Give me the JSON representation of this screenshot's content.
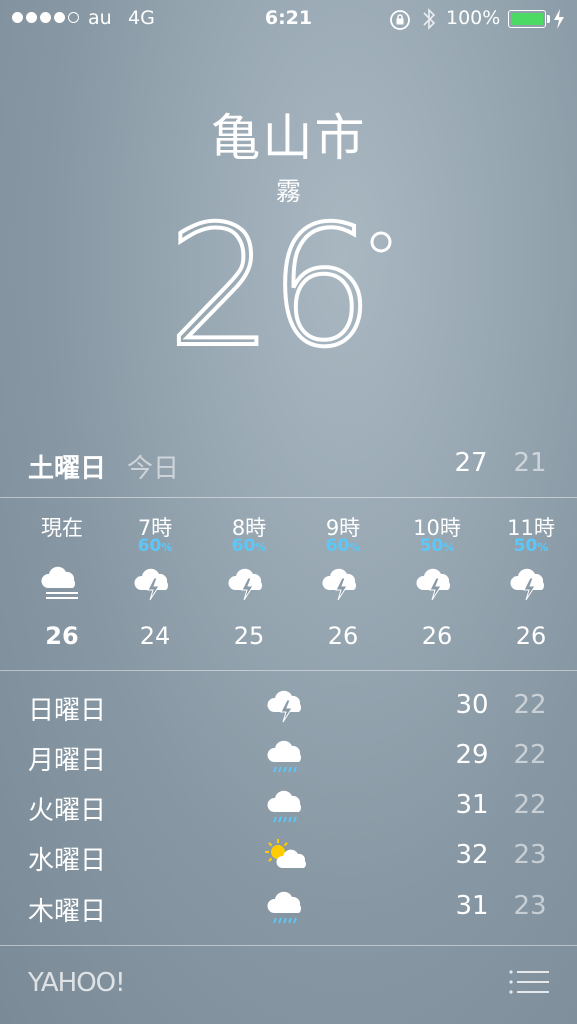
{
  "status_bar": {
    "signal_filled": 4,
    "signal_total": 5,
    "carrier": "au",
    "network": "4G",
    "time": "6:21",
    "battery_percent": "100%",
    "battery_color": "#4cd964"
  },
  "location": {
    "city": "亀山市",
    "condition": "霧",
    "temperature": "26",
    "degree_symbol": "°"
  },
  "today": {
    "day": "土曜日",
    "label": "今日",
    "high": "27",
    "low": "21"
  },
  "hourly": [
    {
      "label": "現在",
      "pop": "",
      "icon": "fog-icon",
      "temp": "26"
    },
    {
      "label": "7時",
      "pop": "60",
      "icon": "thunderstorm-icon",
      "temp": "24"
    },
    {
      "label": "8時",
      "pop": "60",
      "icon": "thunderstorm-icon",
      "temp": "25"
    },
    {
      "label": "9時",
      "pop": "60",
      "icon": "thunderstorm-icon",
      "temp": "26"
    },
    {
      "label": "10時",
      "pop": "50",
      "icon": "thunderstorm-icon",
      "temp": "26"
    },
    {
      "label": "11時",
      "pop": "50",
      "icon": "thunderstorm-icon",
      "temp": "26"
    }
  ],
  "pop_unit": "%",
  "daily": [
    {
      "day": "日曜日",
      "icon": "thunderstorm-icon",
      "high": "30",
      "low": "22"
    },
    {
      "day": "月曜日",
      "icon": "rain-icon",
      "high": "29",
      "low": "22"
    },
    {
      "day": "火曜日",
      "icon": "rain-icon",
      "high": "31",
      "low": "22"
    },
    {
      "day": "水曜日",
      "icon": "partly-sunny-icon",
      "high": "32",
      "low": "23"
    },
    {
      "day": "木曜日",
      "icon": "rain-icon",
      "high": "31",
      "low": "23"
    }
  ],
  "footer": {
    "brand": "YAHOO!",
    "menu_icon": "list-icon"
  },
  "colors": {
    "precip": "#5ac8fa",
    "sun": "#ffcc00",
    "rain": "#5ac8fa"
  }
}
